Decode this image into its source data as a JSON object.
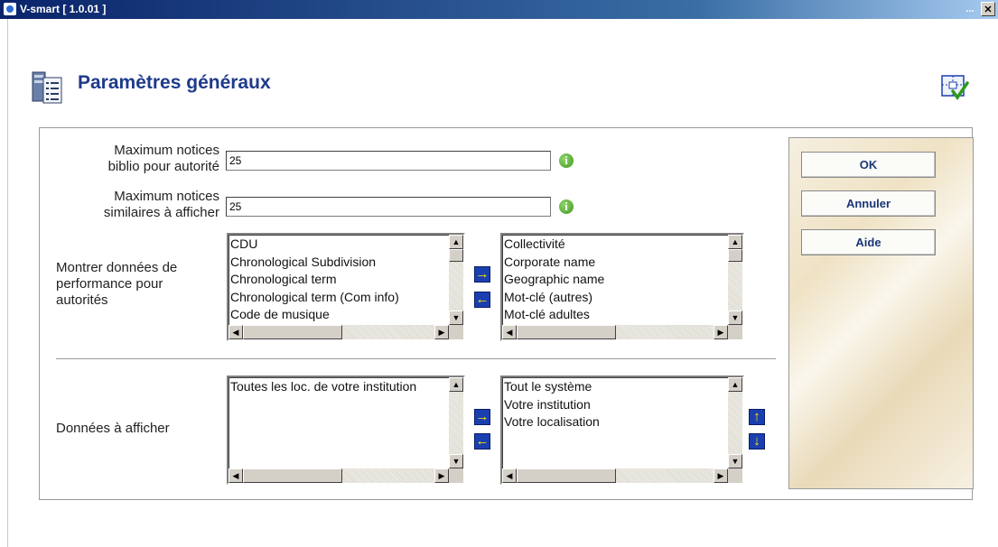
{
  "window": {
    "title": "V-smart [ 1.0.01 ]",
    "minimize_label": "...",
    "close_label": "✕"
  },
  "page": {
    "title": "Paramètres généraux"
  },
  "form": {
    "max_biblio": {
      "label_line1": "Maximum notices",
      "label_line2": "biblio pour autorité",
      "value": "25"
    },
    "max_similar": {
      "label_line1": "Maximum notices",
      "label_line2": "similaires à afficher",
      "value": "25"
    },
    "performance": {
      "label_lines": [
        "Montrer données de",
        "performance pour",
        "autorités"
      ],
      "available": [
        "CDU",
        "Chronological Subdivision",
        "Chronological term",
        "Chronological term (Com info)",
        "Code de musique"
      ],
      "selected": [
        "Collectivité",
        "Corporate name",
        "Geographic name",
        "Mot-clé (autres)",
        "Mot-clé adultes"
      ]
    },
    "display_data": {
      "label": "Données à afficher",
      "available": [
        "Toutes les loc. de votre institution"
      ],
      "selected": [
        "Tout le système",
        "Votre institution",
        "Votre localisation"
      ]
    }
  },
  "buttons": {
    "ok": "OK",
    "cancel": "Annuler",
    "help": "Aide"
  },
  "icons": {
    "info": "info-icon",
    "move_right": "→",
    "move_left": "←",
    "move_up": "↑",
    "move_down": "↓"
  }
}
